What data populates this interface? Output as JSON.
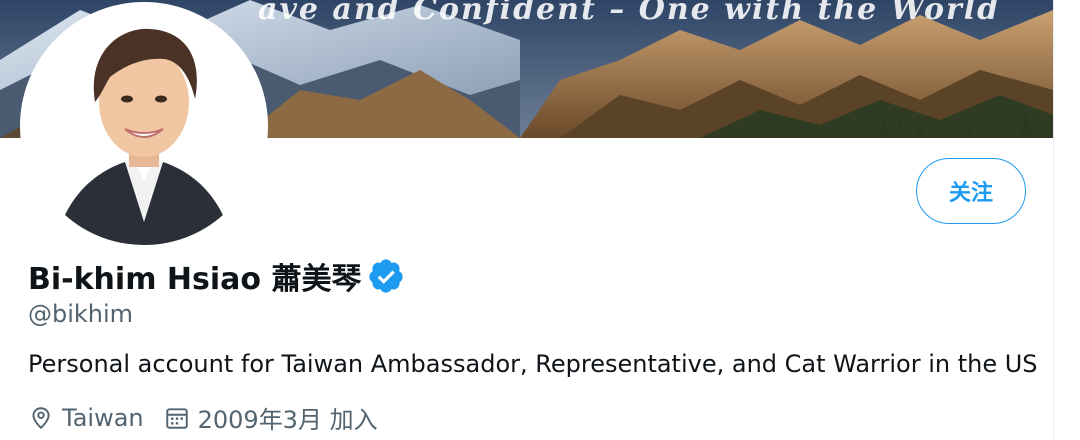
{
  "banner": {
    "tagline": "Brave and Confident – One with the World",
    "visible_tagline": "ave and Confident – One with the World"
  },
  "profile": {
    "display_name": "Bi-khim Hsiao 蕭美琴",
    "handle": "@bikhim",
    "bio": "Personal account for Taiwan Ambassador, Representative, and Cat Warrior in the US",
    "location": "Taiwan",
    "joined": "2009年3月 加入",
    "verified": true
  },
  "actions": {
    "follow_label": "关注"
  },
  "colors": {
    "accent": "#1d9bf0",
    "secondary_text": "#536471",
    "primary_text": "#0f1419"
  },
  "icons": {
    "verified": "verified-badge-icon",
    "location": "location-pin-icon",
    "calendar": "calendar-icon"
  }
}
